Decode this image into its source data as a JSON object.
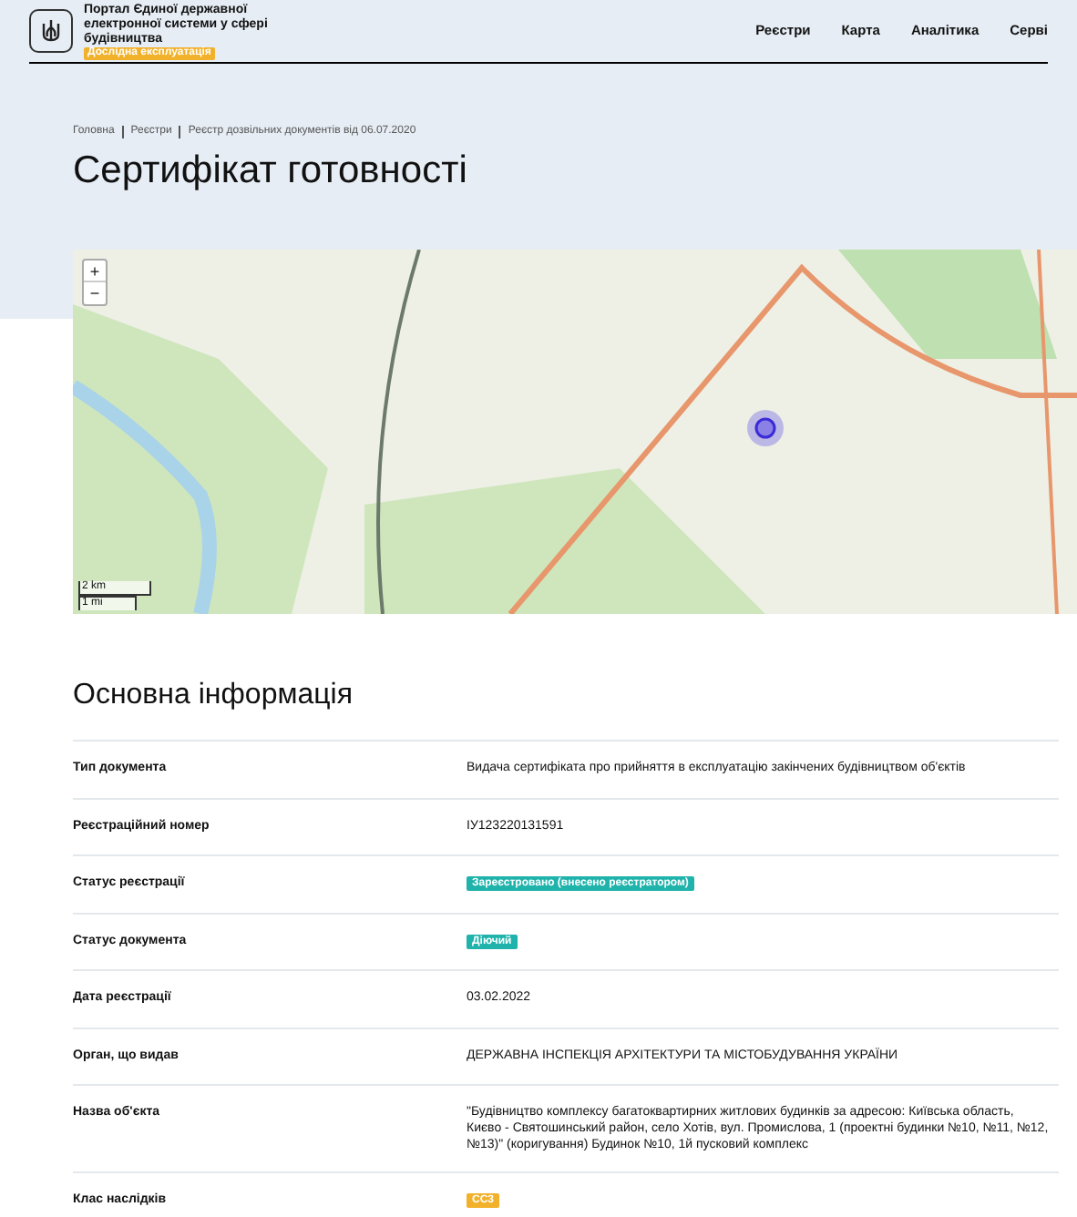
{
  "header": {
    "portal_title": "Портал Єдиної державної електронної системи у сфері будівництва",
    "badge": "Дослідна експлуатація",
    "nav": [
      "Реєстри",
      "Карта",
      "Аналітика",
      "Серві"
    ]
  },
  "breadcrumbs": [
    "Головна",
    "Реєстри",
    "Реєстр дозвільних документів від 06.07.2020"
  ],
  "page_title": "Сертифікат готовності",
  "map": {
    "zoom_in": "+",
    "zoom_out": "−",
    "scale": [
      "2 km",
      "1 mi"
    ]
  },
  "section_title": "Основна інформація",
  "rows": [
    {
      "label": "Тип документа",
      "kind": "text",
      "value": "Видача сертифіката про прийняття в експлуатацію закінчених будівництвом об'єктів"
    },
    {
      "label": "Реєстраційний номер",
      "kind": "text",
      "value": "ІУ123220131591"
    },
    {
      "label": "Статус реєстрації",
      "kind": "badge",
      "value": "Зареєстровано (внесено реєстратором)",
      "color": "#1fb3ab"
    },
    {
      "label": "Статус документа",
      "kind": "badge",
      "value": "Діючий",
      "color": "#1fb3ab"
    },
    {
      "label": "Дата реєстрації",
      "kind": "text",
      "value": "03.02.2022"
    },
    {
      "label": "Орган, що видав",
      "kind": "text",
      "value": "ДЕРЖАВНА ІНСПЕКЦІЯ АРХІТЕКТУРИ ТА МІСТОБУДУВАННЯ УКРАЇНИ"
    },
    {
      "label": "Назва об'єкта",
      "kind": "text",
      "value": "\"Будівництво комплексу багатоквартирних житлових будинків за адресою: Київська область, Києво - Святошинський район, село Хотів, вул. Промислова, 1 (проектні будинки №10, №11, №12, №13)\" (коригування) Будинок №10, 1й пусковий комплекс"
    },
    {
      "label": "Клас наслідків",
      "kind": "badge",
      "value": "СС3",
      "color": "#f2b12b"
    }
  ]
}
